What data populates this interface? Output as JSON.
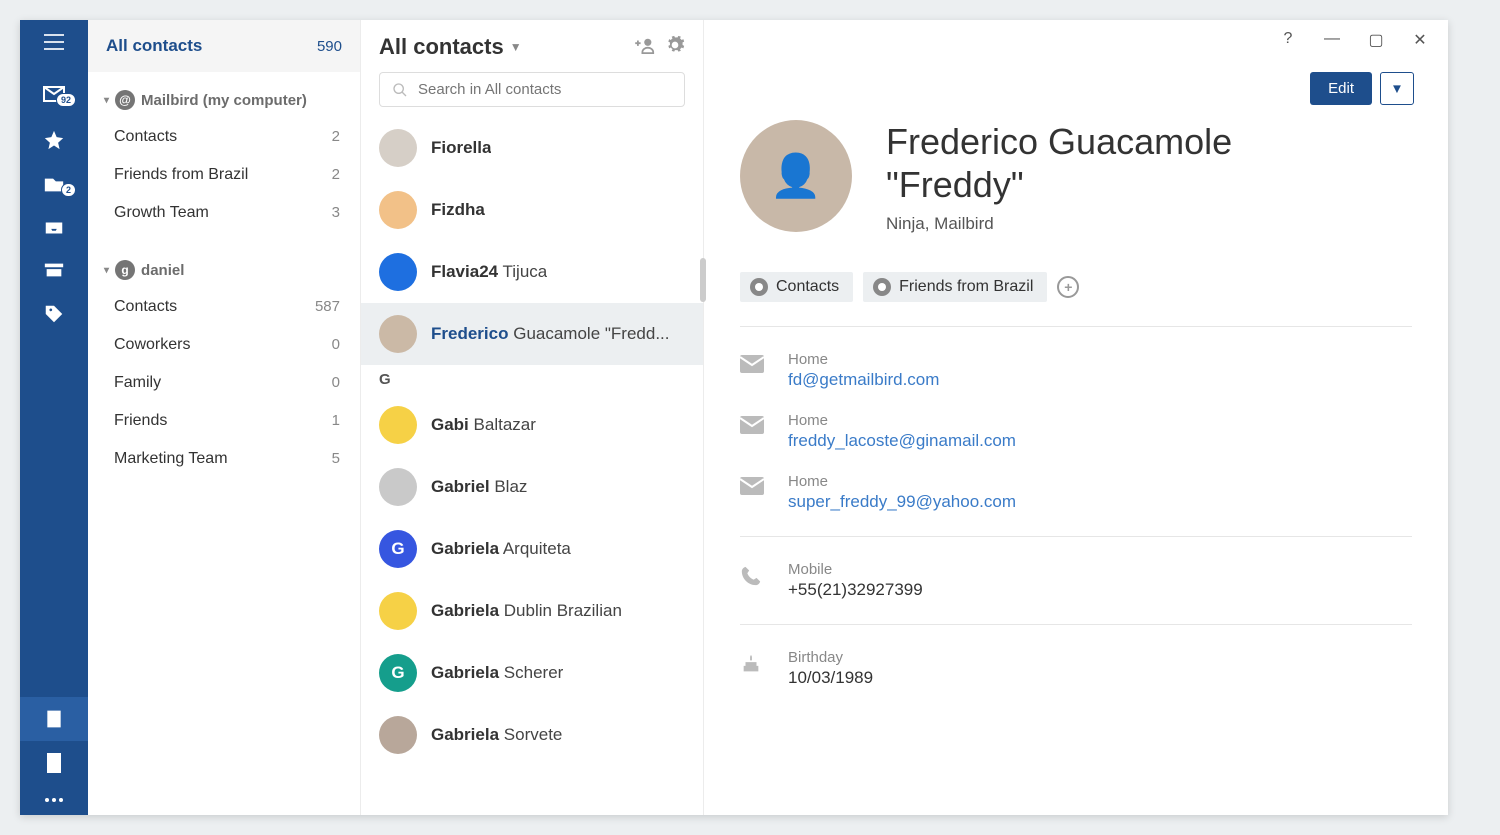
{
  "navrail": {
    "inbox_badge": "92",
    "folder_badge": "2"
  },
  "groups_pane": {
    "header_title": "All contacts",
    "header_count": "590",
    "sections": [
      {
        "title": "Mailbird (my computer)",
        "icon_text": "@",
        "items": [
          {
            "label": "Contacts",
            "count": "2"
          },
          {
            "label": "Friends from Brazil",
            "count": "2"
          },
          {
            "label": "Growth Team",
            "count": "3"
          }
        ]
      },
      {
        "title": "daniel",
        "icon_text": "g",
        "items": [
          {
            "label": "Contacts",
            "count": "587"
          },
          {
            "label": "Coworkers",
            "count": "0"
          },
          {
            "label": "Family",
            "count": "0"
          },
          {
            "label": "Friends",
            "count": "1"
          },
          {
            "label": "Marketing Team",
            "count": "5"
          }
        ]
      }
    ]
  },
  "list_pane": {
    "title": "All contacts",
    "search_placeholder": "Search in All contacts",
    "contacts": [
      {
        "first": "Fiorella",
        "rest": "",
        "avatar_bg": "#d6cfc7",
        "avatar_text": ""
      },
      {
        "first": "Fizdha",
        "rest": "",
        "avatar_bg": "#f2c188",
        "avatar_text": ""
      },
      {
        "first": "Flavia24",
        "rest": "Tijuca",
        "avatar_bg": "#1e6fe0",
        "avatar_text": ""
      },
      {
        "first": "Frederico",
        "rest": "Guacamole \"Fredd...",
        "avatar_bg": "#cbb9a6",
        "avatar_text": "",
        "selected": true
      },
      {
        "section_letter": "G"
      },
      {
        "first": "Gabi",
        "rest": "Baltazar",
        "avatar_bg": "#f6d146",
        "avatar_text": ""
      },
      {
        "first": "Gabriel",
        "rest": "Blaz",
        "avatar_bg": "#c9c9c9",
        "avatar_text": ""
      },
      {
        "first": "Gabriela",
        "rest": "Arquiteta",
        "avatar_bg": "#3656e0",
        "avatar_text": "G"
      },
      {
        "first": "Gabriela",
        "rest": "Dublin Brazilian",
        "avatar_bg": "#f6d146",
        "avatar_text": ""
      },
      {
        "first": "Gabriela",
        "rest": "Scherer",
        "avatar_bg": "#159e8c",
        "avatar_text": "G"
      },
      {
        "first": "Gabriela",
        "rest": "Sorvete",
        "avatar_bg": "#b8a79a",
        "avatar_text": ""
      }
    ]
  },
  "detail": {
    "edit_label": "Edit",
    "name_line1": "Frederico Guacamole",
    "name_line2": "\"Freddy\"",
    "subtitle": "Ninja, Mailbird",
    "tags": [
      {
        "label": "Contacts"
      },
      {
        "label": "Friends from Brazil"
      }
    ],
    "emails": [
      {
        "label": "Home",
        "value": "fd@getmailbird.com"
      },
      {
        "label": "Home",
        "value": "freddy_lacoste@ginamail.com"
      },
      {
        "label": "Home",
        "value": "super_freddy_99@yahoo.com"
      }
    ],
    "phone": {
      "label": "Mobile",
      "value": "+55(21)32927399"
    },
    "birthday": {
      "label": "Birthday",
      "value": "10/03/1989"
    }
  }
}
